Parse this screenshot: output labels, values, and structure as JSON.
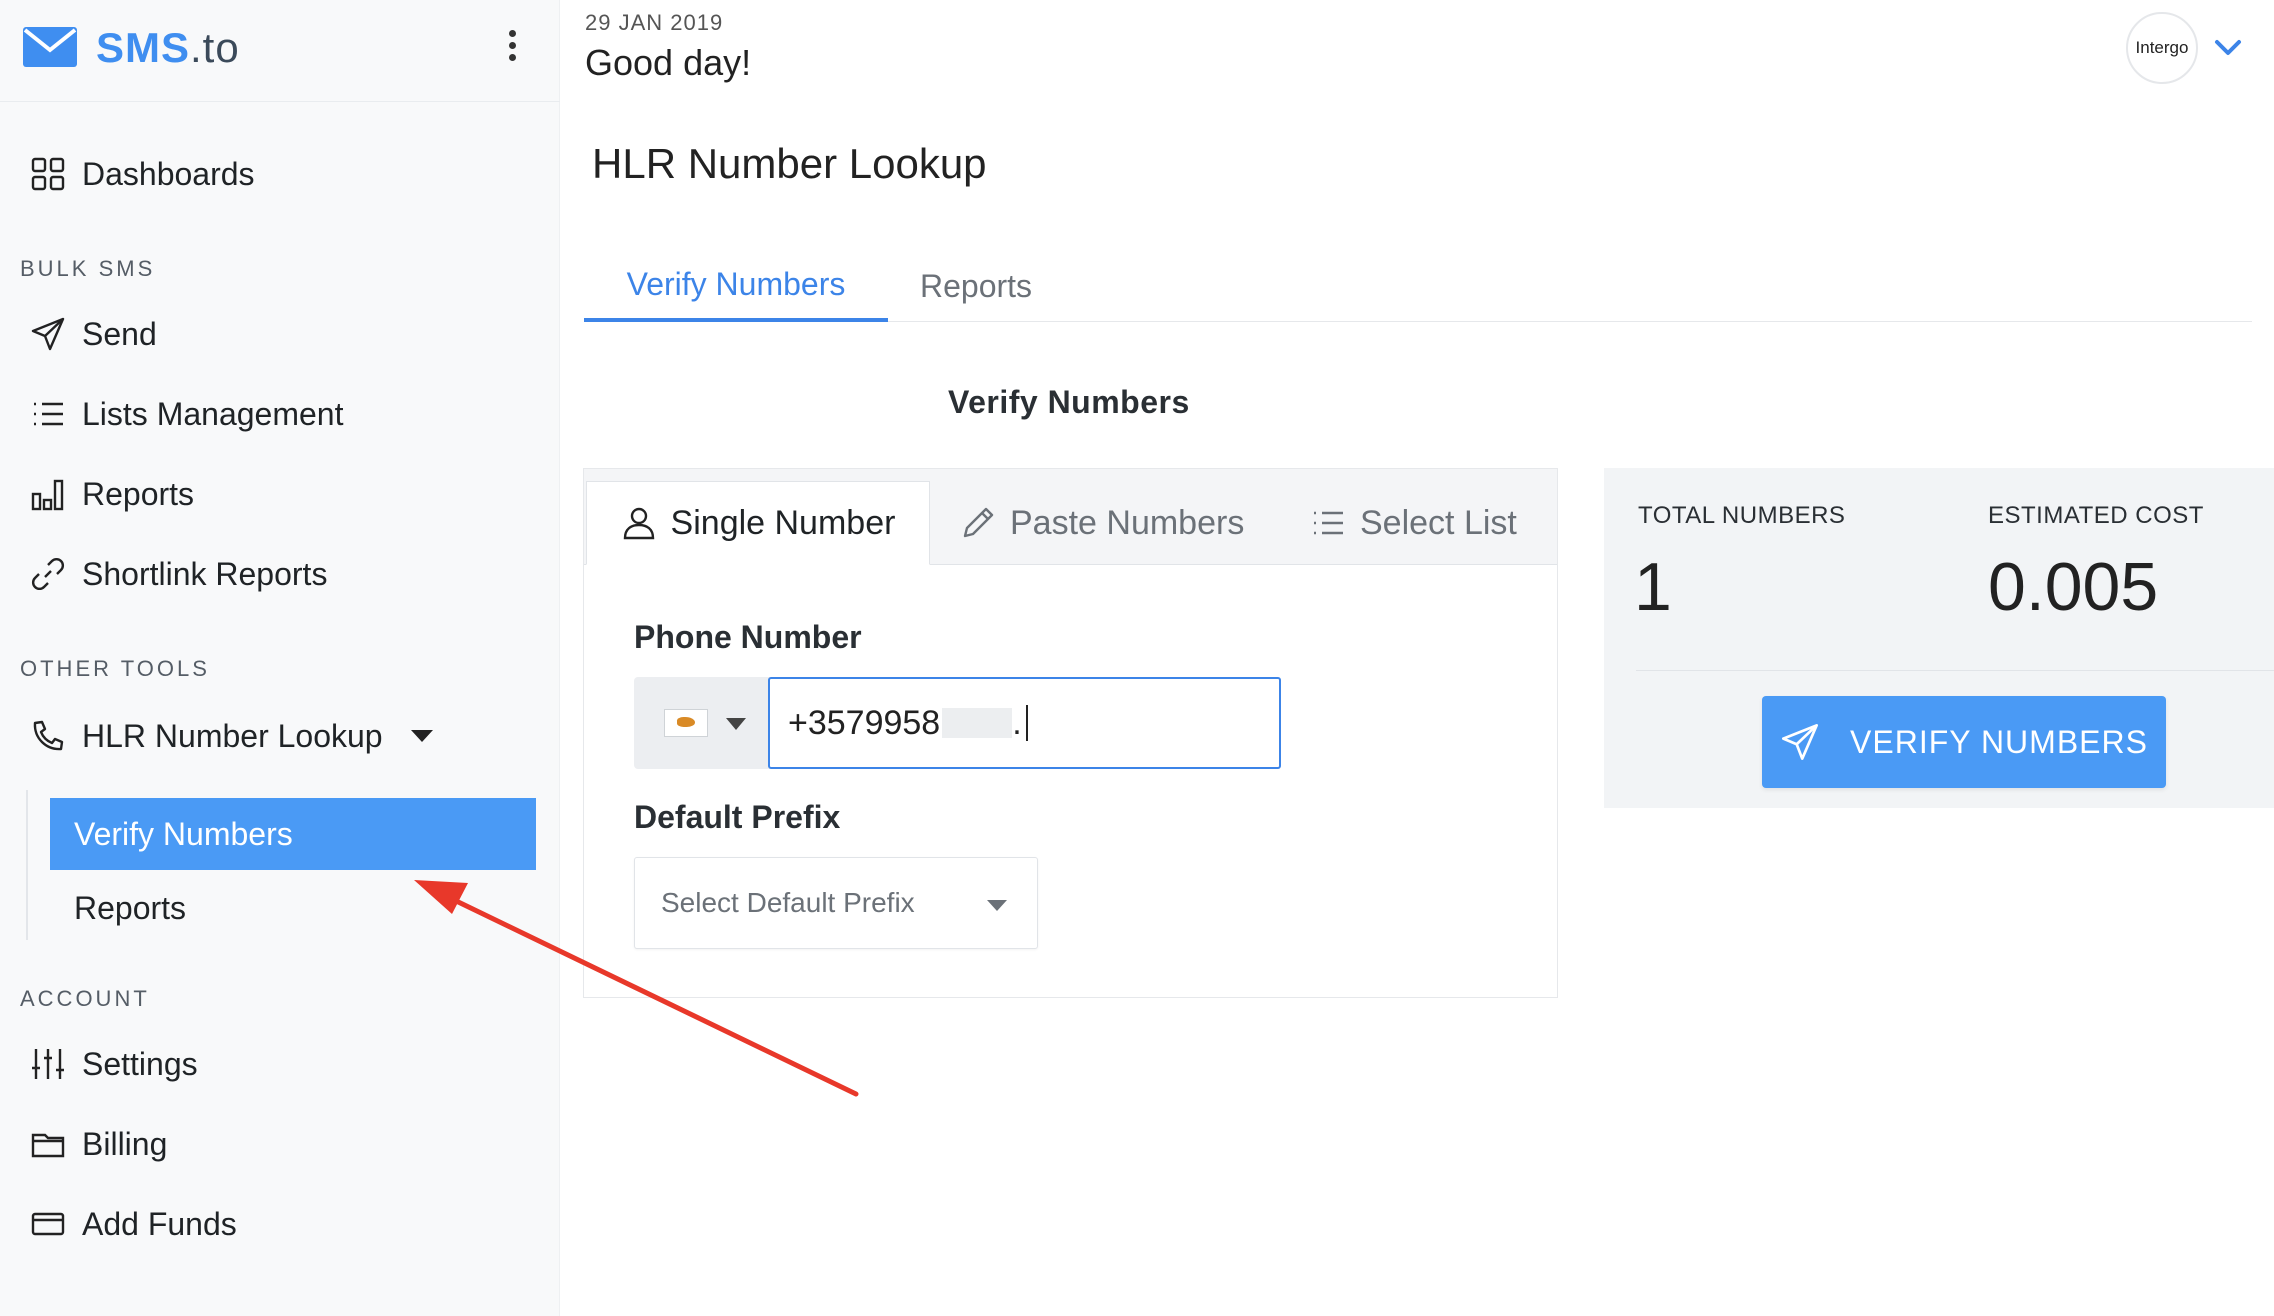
{
  "brand": {
    "name_main": "SMS",
    "name_suffix": ".to"
  },
  "sidebar": {
    "dashboards": "Dashboards",
    "section_bulk": "BULK SMS",
    "send": "Send",
    "lists": "Lists Management",
    "reports": "Reports",
    "shortlink": "Shortlink Reports",
    "section_tools": "OTHER TOOLS",
    "hlr": "HLR Number Lookup",
    "sub_verify": "Verify Numbers",
    "sub_reports": "Reports",
    "section_account": "ACCOUNT",
    "settings": "Settings",
    "billing": "Billing",
    "add_funds": "Add Funds"
  },
  "header": {
    "date": "29 JAN 2019",
    "greeting": "Good day!",
    "avatar_text": "Intergo"
  },
  "page": {
    "title": "HLR Number Lookup",
    "tabs": [
      "Verify Numbers",
      "Reports"
    ],
    "subheading": "Verify Numbers"
  },
  "form": {
    "input_tabs": [
      "Single Number",
      "Paste Numbers",
      "Select List"
    ],
    "phone_label": "Phone Number",
    "phone_value": "+3579958",
    "phone_value_suffix": ".",
    "prefix_label": "Default Prefix",
    "prefix_placeholder": "Select Default Prefix"
  },
  "summary": {
    "total_label": "TOTAL NUMBERS",
    "total_value": "1",
    "cost_label": "ESTIMATED COST",
    "cost_value": "0.005",
    "button_label": "VERIFY NUMBERS"
  },
  "colors": {
    "accent": "#3c84e8",
    "button": "#4a9af5",
    "annotation": "#e8382a"
  }
}
